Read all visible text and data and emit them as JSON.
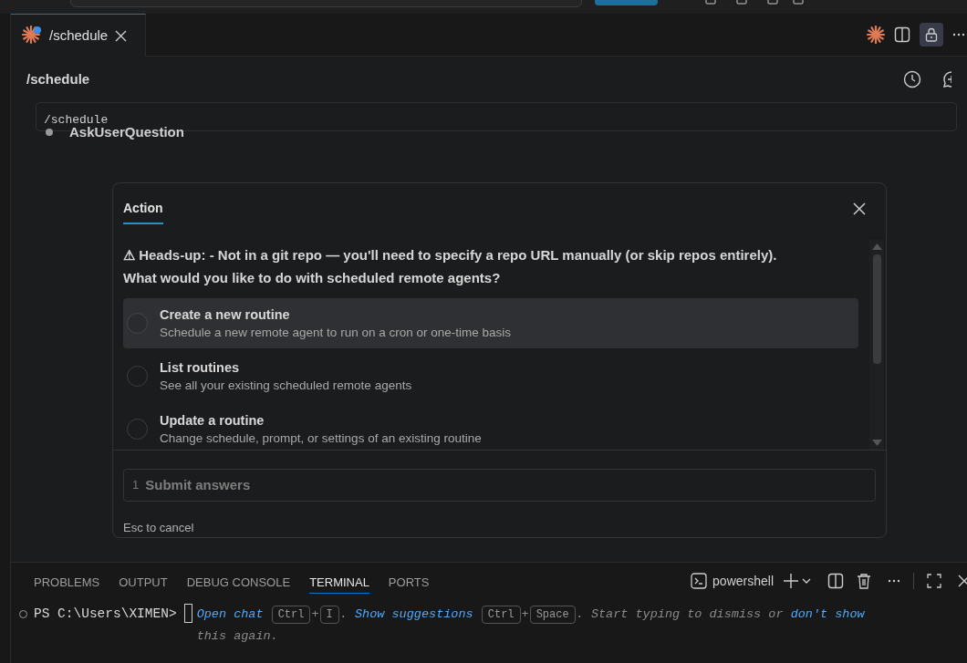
{
  "editor_tabs": [
    {
      "label": "/schedule",
      "selected": true,
      "modified": true
    }
  ],
  "header": {
    "title": "/schedule"
  },
  "code_block": {
    "text": "/schedule"
  },
  "tool_call": {
    "name": "AskUserQuestion"
  },
  "dialog": {
    "tabs": [
      {
        "label": "Action",
        "selected": true
      }
    ],
    "question_lines": [
      "⚠ Heads-up: - Not in a git repo — you'll need to specify a repo URL manually (or skip repos entirely).",
      "What would you like to do with scheduled remote agents?"
    ],
    "options": [
      {
        "title": "Create a new routine",
        "description": "Schedule a new remote agent to run on a cron or one-time basis",
        "selected": true
      },
      {
        "title": "List routines",
        "description": "See all your existing scheduled remote agents",
        "selected": false
      },
      {
        "title": "Update a routine",
        "description": "Change schedule, prompt, or settings of an existing routine",
        "selected": false
      }
    ],
    "submit": {
      "number": "1",
      "label": "Submit answers"
    },
    "hint": "Esc to cancel"
  },
  "panel": {
    "tabs": [
      {
        "label": "PROBLEMS",
        "selected": false
      },
      {
        "label": "OUTPUT",
        "selected": false
      },
      {
        "label": "DEBUG CONSOLE",
        "selected": false
      },
      {
        "label": "TERMINAL",
        "selected": true
      },
      {
        "label": "PORTS",
        "selected": false
      }
    ],
    "terminal_name": "powershell",
    "prompt": "PS C:\\Users\\XIMEN>",
    "hint": [
      {
        "kind": "link",
        "text": "Open chat"
      },
      {
        "kind": "key",
        "text": "Ctrl"
      },
      {
        "kind": "plain",
        "text": "+"
      },
      {
        "kind": "key",
        "text": "I"
      },
      {
        "kind": "plain",
        "text": "."
      },
      {
        "kind": "link",
        "text": "Show suggestions"
      },
      {
        "kind": "key",
        "text": "Ctrl"
      },
      {
        "kind": "plain",
        "text": "+"
      },
      {
        "kind": "key",
        "text": "Space"
      },
      {
        "kind": "plain",
        "text": ". Start typing to dismiss or"
      },
      {
        "kind": "link",
        "text": "don't"
      },
      {
        "kind": "link",
        "text": "show"
      },
      {
        "kind": "plain",
        "text": "this again."
      }
    ]
  }
}
